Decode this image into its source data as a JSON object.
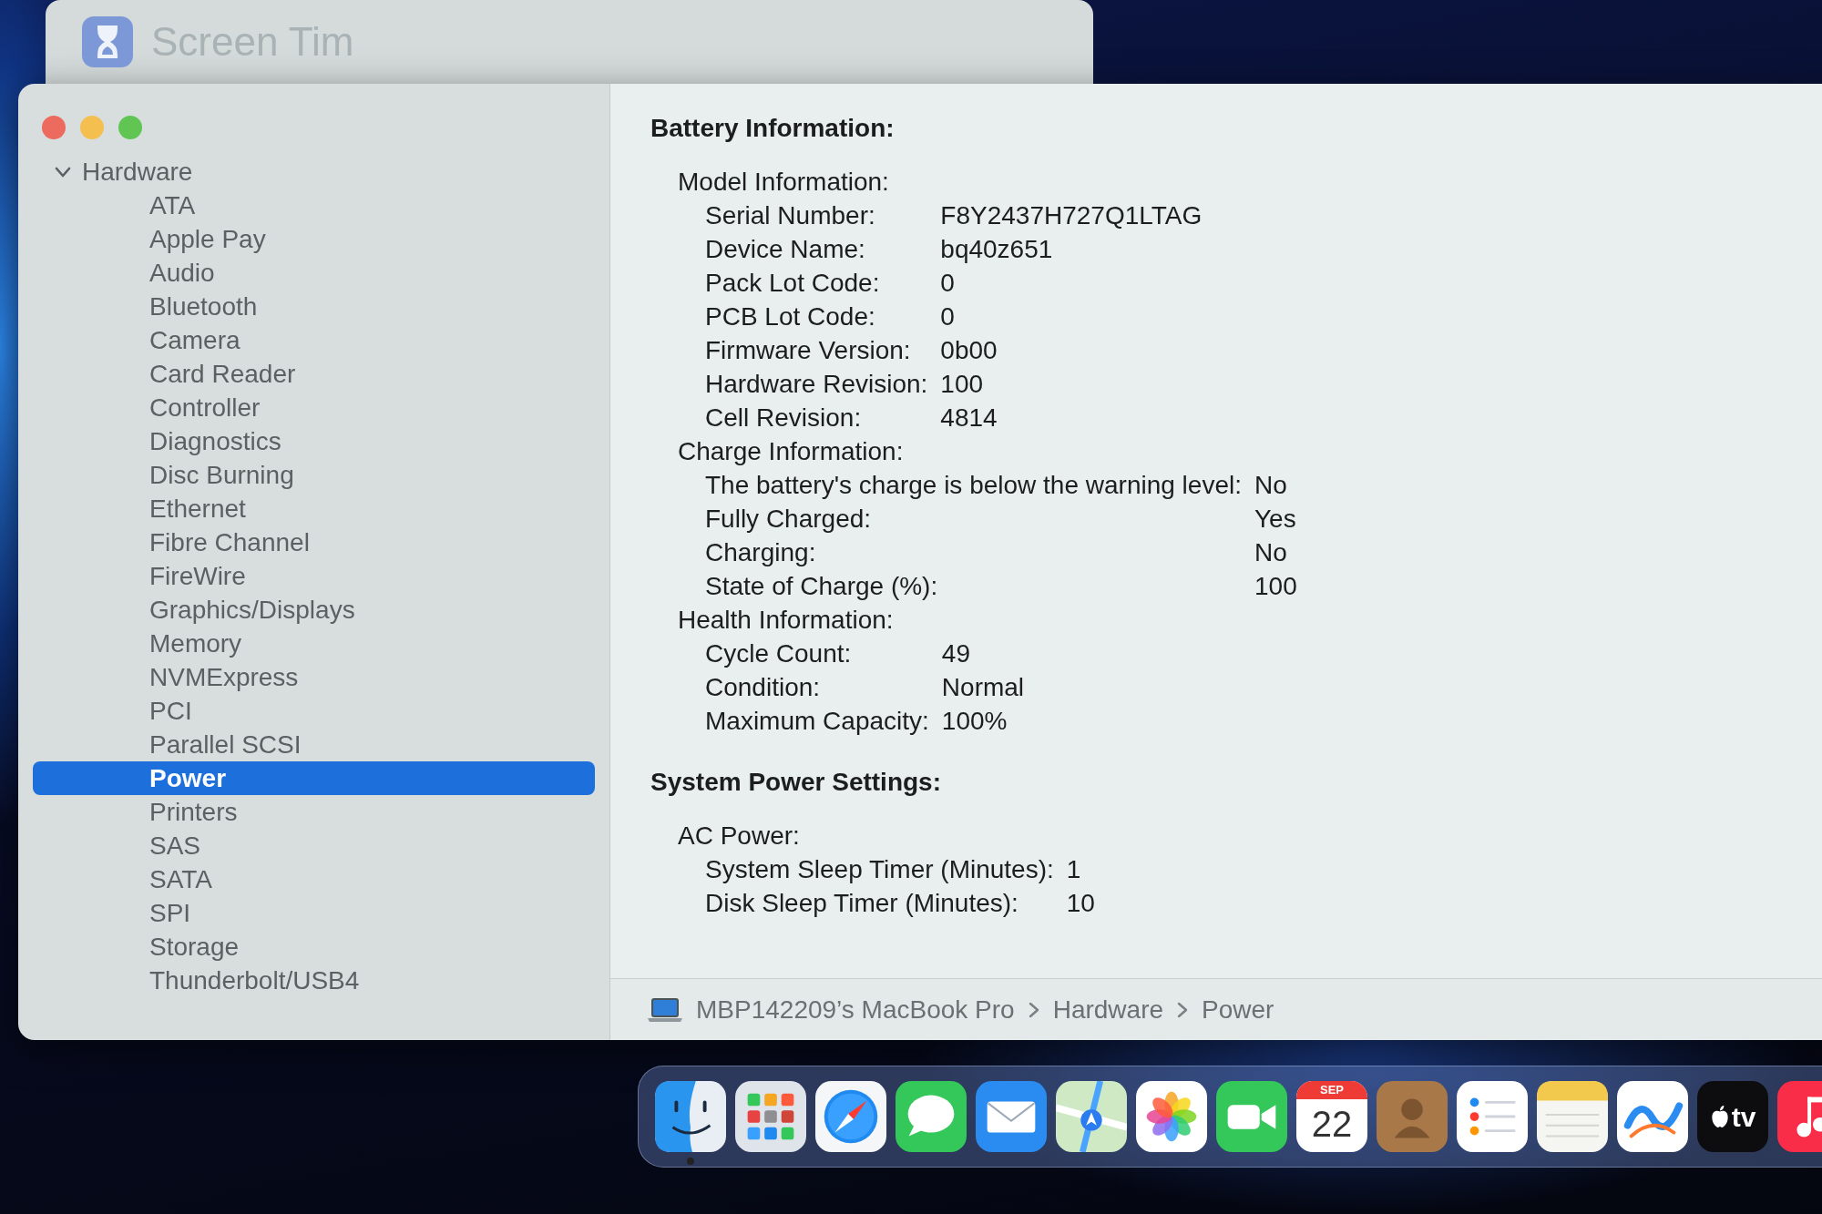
{
  "background_window": {
    "title": "Screen Tim"
  },
  "window": {
    "sidebar": {
      "items": [
        {
          "label": "Hardware",
          "expanded": true,
          "children": [
            {
              "label": "ATA",
              "selected": false
            },
            {
              "label": "Apple Pay",
              "selected": false
            },
            {
              "label": "Audio",
              "selected": false
            },
            {
              "label": "Bluetooth",
              "selected": false
            },
            {
              "label": "Camera",
              "selected": false
            },
            {
              "label": "Card Reader",
              "selected": false
            },
            {
              "label": "Controller",
              "selected": false
            },
            {
              "label": "Diagnostics",
              "selected": false
            },
            {
              "label": "Disc Burning",
              "selected": false
            },
            {
              "label": "Ethernet",
              "selected": false
            },
            {
              "label": "Fibre Channel",
              "selected": false
            },
            {
              "label": "FireWire",
              "selected": false
            },
            {
              "label": "Graphics/Displays",
              "selected": false
            },
            {
              "label": "Memory",
              "selected": false
            },
            {
              "label": "NVMExpress",
              "selected": false
            },
            {
              "label": "PCI",
              "selected": false
            },
            {
              "label": "Parallel SCSI",
              "selected": false
            },
            {
              "label": "Power",
              "selected": true
            },
            {
              "label": "Printers",
              "selected": false
            },
            {
              "label": "SAS",
              "selected": false
            },
            {
              "label": "SATA",
              "selected": false
            },
            {
              "label": "SPI",
              "selected": false
            },
            {
              "label": "Storage",
              "selected": false
            },
            {
              "label": "Thunderbolt/USB4",
              "selected": false
            }
          ]
        }
      ]
    },
    "details": {
      "sections": [
        {
          "label": "Battery Information:",
          "children": [
            {
              "label": "Model Information:",
              "children": [
                {
                  "label": "Serial Number:",
                  "value": "F8Y2437H727Q1LTAG"
                },
                {
                  "label": "Device Name:",
                  "value": "bq40z651"
                },
                {
                  "label": "Pack Lot Code:",
                  "value": "0"
                },
                {
                  "label": "PCB Lot Code:",
                  "value": "0"
                },
                {
                  "label": "Firmware Version:",
                  "value": "0b00"
                },
                {
                  "label": "Hardware Revision:",
                  "value": "100"
                },
                {
                  "label": "Cell Revision:",
                  "value": "4814"
                }
              ]
            },
            {
              "label": "Charge Information:",
              "children": [
                {
                  "label": "The battery's charge is below the warning level:",
                  "value": "No"
                },
                {
                  "label": "Fully Charged:",
                  "value": "Yes"
                },
                {
                  "label": "Charging:",
                  "value": "No"
                },
                {
                  "label": "State of Charge (%):",
                  "value": "100"
                }
              ]
            },
            {
              "label": "Health Information:",
              "children": [
                {
                  "label": "Cycle Count:",
                  "value": "49"
                },
                {
                  "label": "Condition:",
                  "value": "Normal"
                },
                {
                  "label": "Maximum Capacity:",
                  "value": "100%"
                }
              ]
            }
          ]
        },
        {
          "label": "System Power Settings:",
          "children": [
            {
              "label": "AC Power:",
              "children": [
                {
                  "label": "System Sleep Timer (Minutes):",
                  "value": "1"
                },
                {
                  "label": "Disk Sleep Timer (Minutes):",
                  "value": "10"
                }
              ]
            }
          ]
        }
      ]
    },
    "path_bar": {
      "items": [
        "MBP142209’s MacBook Pro",
        "Hardware",
        "Power"
      ]
    }
  },
  "dock": {
    "items": [
      {
        "kind": "finder",
        "running": true
      },
      {
        "kind": "launchpad",
        "running": false
      },
      {
        "kind": "safari",
        "running": false
      },
      {
        "kind": "messages",
        "running": false
      },
      {
        "kind": "mail",
        "running": false
      },
      {
        "kind": "maps",
        "running": false
      },
      {
        "kind": "photos",
        "running": false
      },
      {
        "kind": "facetime",
        "running": false
      },
      {
        "kind": "calendar",
        "month": "SEP",
        "day": "22",
        "running": false
      },
      {
        "kind": "contacts",
        "running": false
      },
      {
        "kind": "reminders",
        "running": false
      },
      {
        "kind": "notes",
        "running": false
      },
      {
        "kind": "freeform",
        "running": false
      },
      {
        "kind": "tv",
        "label": "tv",
        "running": false
      },
      {
        "kind": "music",
        "running": false
      }
    ]
  }
}
